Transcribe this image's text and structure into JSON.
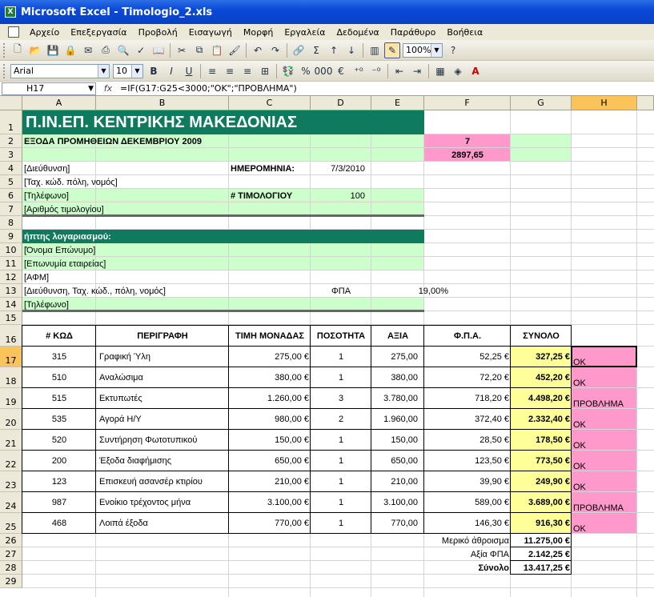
{
  "window": {
    "title": "Microsoft Excel - Timologio_2.xls"
  },
  "menu": [
    "Αρχείο",
    "Επεξεργασία",
    "Προβολή",
    "Εισαγωγή",
    "Μορφή",
    "Εργαλεία",
    "Δεδομένα",
    "Παράθυρο",
    "Βοήθεια"
  ],
  "toolbar": {
    "zoom": "100%",
    "font": "Arial",
    "size": "10"
  },
  "formula_bar": {
    "cell": "H17",
    "fx": "fx",
    "formula": "=IF(G17:G25<3000;\"OK\";\"ΠΡΟΒΛΗΜΑ\")"
  },
  "columns": [
    "A",
    "B",
    "C",
    "D",
    "E",
    "F",
    "G",
    "H"
  ],
  "colors": {
    "dark_green": "#0f7a5e",
    "light_green": "#ccffcc",
    "pink": "#ff99cc",
    "yellow": "#ffff99",
    "select": "#fbc45a"
  },
  "sheet": {
    "title": "Π.ΙΝ.ΕΠ. ΚΕΝΤΡΙΚΗΣ ΜΑΚΕΔΟΝΙΑΣ",
    "subtitle": "ΕΞΟΔΑ ΠΡΟΜΗΘΕΙΩΝ ΔΕΚΕΜΒΡΙΟΥ 2009",
    "f2": "7",
    "f3": "2897,65",
    "address": "[Διεύθυνση]",
    "date_label": "ΗΜΕΡΟΜΗΝΙΑ:",
    "date_value": "7/3/2010",
    "postal": "[Ταχ. κώδ. πόλη, νομός]",
    "phone": "[Τηλέφωνο]",
    "invoice_label": "# ΤΙΜΟΛΟΓΙΟΥ",
    "invoice_value": "100",
    "invoice_number": "[Αριθμός τιμολογίου]",
    "account_title": "ήπτης λογαριασμού:",
    "name": "[Όνομα Επώνυμο]",
    "company": "[Επωνυμία εταιρείας]",
    "afm": "[ΑΦΜ]",
    "address_full": "[Διεύθυνση, Ταχ. κώδ., πόλη, νομός]",
    "vat_label": "ΦΠΑ",
    "vat_value": "19,00%",
    "phone2": "[Τηλέφωνο]",
    "headers": [
      "# ΚΩΔ",
      "ΠΕΡΙΓΡΑΦΗ",
      "ΤΙΜΗ ΜΟΝΑΔΑΣ",
      "ΠΟΣΟΤΗΤΑ",
      "ΑΞΙΑ",
      "Φ.Π.Α.",
      "ΣΥΝΟΛΟ"
    ],
    "items": [
      {
        "code": "315",
        "desc": "Γραφική Ύλη",
        "price": "275,00 €",
        "qty": "1",
        "value": "275,00",
        "vat": "52,25 €",
        "total": "327,25 €",
        "check": "OK"
      },
      {
        "code": "510",
        "desc": "Αναλώσιμα",
        "price": "380,00 €",
        "qty": "1",
        "value": "380,00",
        "vat": "72,20 €",
        "total": "452,20 €",
        "check": "OK"
      },
      {
        "code": "515",
        "desc": "Εκτυπωτές",
        "price": "1.260,00 €",
        "qty": "3",
        "value": "3.780,00",
        "vat": "718,20 €",
        "total": "4.498,20 €",
        "check": "ΠΡΟΒΛΗΜΑ"
      },
      {
        "code": "535",
        "desc": "Αγορά Η/Υ",
        "price": "980,00 €",
        "qty": "2",
        "value": "1.960,00",
        "vat": "372,40 €",
        "total": "2.332,40 €",
        "check": "OK"
      },
      {
        "code": "520",
        "desc": "Συντήρηση Φωτοτυπικού",
        "price": "150,00 €",
        "qty": "1",
        "value": "150,00",
        "vat": "28,50 €",
        "total": "178,50 €",
        "check": "OK"
      },
      {
        "code": "200",
        "desc": "Έξοδα διαφήμισης",
        "price": "650,00 €",
        "qty": "1",
        "value": "650,00",
        "vat": "123,50 €",
        "total": "773,50 €",
        "check": "OK"
      },
      {
        "code": "123",
        "desc": "Επισκευή ασανσέρ κτιρίου",
        "price": "210,00 €",
        "qty": "1",
        "value": "210,00",
        "vat": "39,90 €",
        "total": "249,90 €",
        "check": "OK"
      },
      {
        "code": "987",
        "desc": "Ενοίκιο τρέχοντος μήνα",
        "price": "3.100,00 €",
        "qty": "1",
        "value": "3.100,00",
        "vat": "589,00 €",
        "total": "3.689,00 €",
        "check": "ΠΡΟΒΛΗΜΑ"
      },
      {
        "code": "468",
        "desc": "Λοιπά έξοδα",
        "price": "770,00 €",
        "qty": "1",
        "value": "770,00",
        "vat": "146,30 €",
        "total": "916,30 €",
        "check": "OK"
      }
    ],
    "subtotal_label": "Μερικό άθροισμα",
    "subtotal": "11.275,00 €",
    "vat_total_label": "Αξία ΦΠΑ",
    "vat_total": "2.142,25 €",
    "total_label": "Σύνολο",
    "total": "13.417,25 €"
  }
}
